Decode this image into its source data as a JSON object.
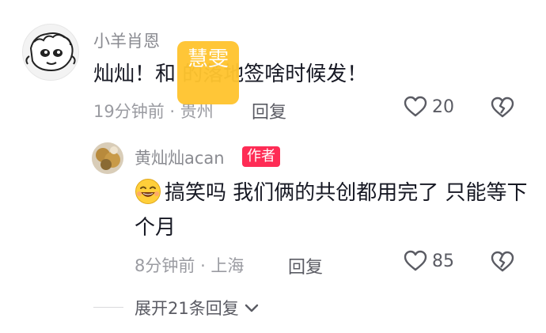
{
  "comments": [
    {
      "username": "小羊肖恩",
      "text": "灿灿！和 的落地签啥时候发！",
      "time": "19分钟前",
      "location": "贵州",
      "reply_label": "回复",
      "like_count": "20",
      "avatar_icon": "cartoon-sheep-avatar"
    },
    {
      "username": "黄灿灿acan",
      "badge": "作者",
      "emoji_icon": "laughing-emoji-icon",
      "text": "搞笑吗 我们俩的共创都用完了 只能等下个月",
      "time": "8分钟前",
      "location": "上海",
      "reply_label": "回复",
      "like_count": "85",
      "avatar_icon": "user-photo-avatar"
    }
  ],
  "expand_replies": {
    "label": "展开21条回复"
  },
  "watermark": {
    "text": "慧雯"
  },
  "colors": {
    "badge": "#fe2c55",
    "watermark": "#ffc42f",
    "muted": "#9a9ba1",
    "text": "#161823"
  }
}
